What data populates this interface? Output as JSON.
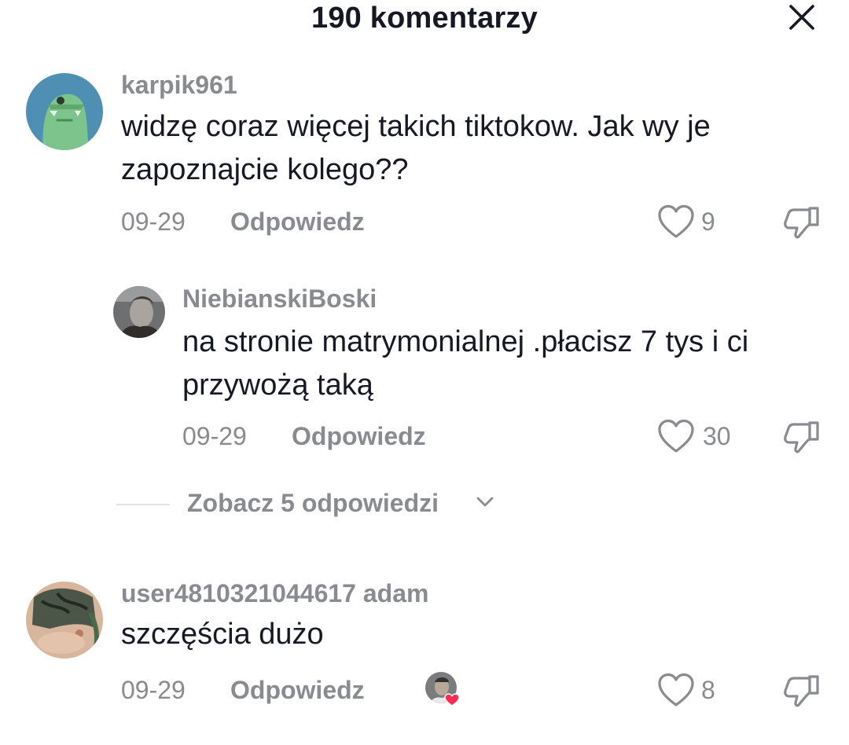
{
  "header": {
    "title": "190 komentarzy",
    "close_icon": "close-icon"
  },
  "comments": [
    {
      "username": "karpik961",
      "text": "widzę coraz więcej takich tiktokow. Jak wy je zapoznajcie kolego??",
      "date": "09-29",
      "reply_label": "Odpowiedz",
      "likes": "9",
      "replies": [
        {
          "username": "NiebianskiBoski",
          "text": "na stronie matrymonialnej .płacisz 7 tys i ci przywożą taką",
          "date": "09-29",
          "reply_label": "Odpowiedz",
          "likes": "30"
        }
      ],
      "view_replies_label": "Zobacz 5 odpowiedzi"
    },
    {
      "username": "user4810321044617 adam",
      "text": "szczęścia dużo",
      "date": "09-29",
      "reply_label": "Odpowiedz",
      "likes": "8",
      "liked_by_creator": true
    }
  ],
  "colors": {
    "primary_text": "#161823",
    "secondary_text": "#8a8b91",
    "heart_red": "#fe2c55"
  }
}
